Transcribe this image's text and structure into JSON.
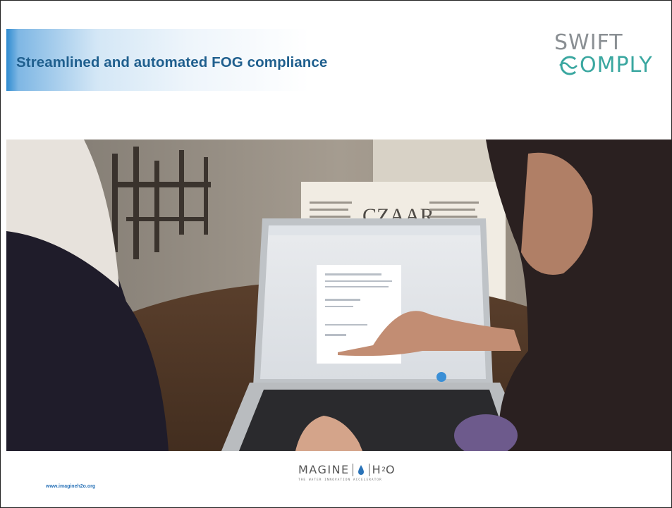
{
  "slide": {
    "title": "Streamlined and automated FOG compliance",
    "footer_url": "www.imagineh2o.org"
  },
  "logo_swiftcomply": {
    "line1": "SWIFT",
    "line2": "OMPLY"
  },
  "logo_imagine": {
    "word": "MAGINE",
    "h": "H",
    "sub": "2",
    "o": "O",
    "tagline": "THE WATER INNOVATION ACCELERATOR"
  },
  "photo": {
    "menu_title": "CZAAR"
  },
  "colors": {
    "title": "#1f5f8e",
    "accent_blue": "#2e8bd0",
    "swift_gray": "#8a8f93",
    "comply_teal": "#3aa7a0",
    "footer_link": "#2a73b8"
  }
}
